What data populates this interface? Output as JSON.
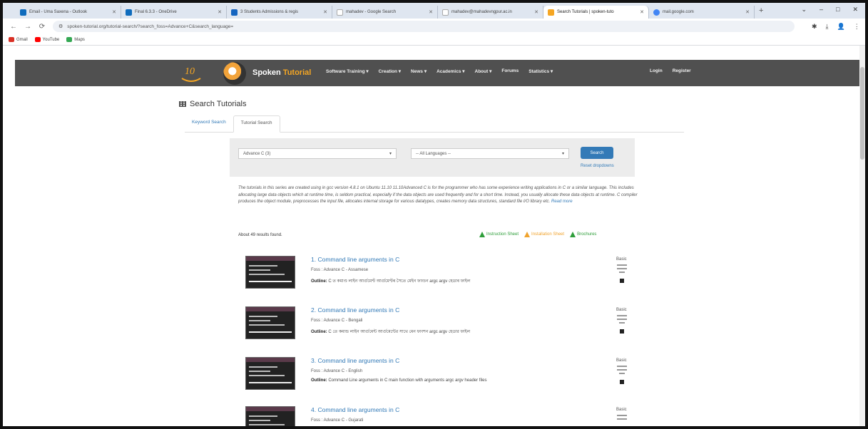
{
  "browser": {
    "tabs": [
      {
        "title": "Email - Uma Saxena - Outlook",
        "color": "#0f6cbd",
        "active": false
      },
      {
        "title": "Final 6.3.3 - OneDrive",
        "color": "#0f6cbd",
        "active": false
      },
      {
        "title": "3 Students Admissions & regis",
        "color": "#1565c0",
        "active": false
      },
      {
        "title": "mahadev - Google Search",
        "color": "#ffffff",
        "active": false
      },
      {
        "title": "mahadev@mahadevngpur.ac.in",
        "color": "#ffffff",
        "active": false
      },
      {
        "title": "Search Tutorials | spoken-tuto",
        "color": "#f5a623",
        "active": true
      },
      {
        "title": "mail.google.com",
        "color": "#4285f4",
        "active": false
      }
    ],
    "new_tab": "+",
    "window_controls": {
      "dropdown": "⌄",
      "minimize": "–",
      "maximize": "□",
      "close": "✕"
    },
    "nav": {
      "back": "←",
      "forward": "→",
      "reload": "⟳"
    },
    "url": "spoken-tutorial.org/tutorial-search/?search_foss=Advance+C&search_language=",
    "toolbar_icons": {
      "extensions": "✱",
      "download": "⤓",
      "profile": "👤",
      "menu": "⋮"
    },
    "bookmarks": [
      {
        "label": "Gmail",
        "color": "#d93025"
      },
      {
        "label": "YouTube",
        "color": "#ff0000"
      },
      {
        "label": "Maps",
        "color": "#34a853"
      }
    ]
  },
  "site": {
    "logo_text": "10",
    "brand_main": "Spoken",
    "brand_accent": " Tutorial",
    "menu": [
      "Software Training ▾",
      "Creation ▾",
      "News ▾",
      "Academics ▾",
      "About ▾",
      "Forums",
      "Statistics ▾"
    ],
    "menu_right": [
      "Login",
      "Register"
    ]
  },
  "page": {
    "heading": "Search Tutorials",
    "tabs": [
      {
        "label": "Keyword Search",
        "active": false
      },
      {
        "label": "Tutorial Search",
        "active": true
      }
    ],
    "filter": {
      "foss_value": "Advance C (3)",
      "language_value": "-- All Languages --",
      "search_label": "Search",
      "reset_label": "Reset dropdowns"
    },
    "description": "The tutorials in this series are created using in gcc version 4.8.1 on Ubuntu 11.10 11.10Advanced C is for the programmer who has some experience writing applications in C or a similar language. This includes allocating large data objects which at runtime time, is seldom practical, especially if the data objects are used frequently and for a short time. Instead, you usually allocate these data objects at runtime. C compiler produces the object module, preprocesses the input file, allocates internal storage for various datatypes, creates memory data structures, standard file I/O library etc.",
    "read_more": "Read more",
    "found_text": "About 49 results found.",
    "legend": [
      {
        "label": "Instruction Sheet",
        "color": "#2e9e3a"
      },
      {
        "label": "Installation Sheet",
        "color": "#f0a32e"
      },
      {
        "label": "Brochures",
        "color": "#2e9e3a"
      }
    ],
    "results": [
      {
        "title": "1. Command line arguments in C",
        "foss": "Foss : Advance C - Assamese",
        "outline_label": "Outline:",
        "outline": "C ত কমাণ্ড লাইন আৰ্গুমেণ্ট আৰ্গুমেণ্টৰ সৈতে মেইন ফাংচন argc argv হেডাৰ ফাইল",
        "level": "Basic"
      },
      {
        "title": "2. Command line arguments in C",
        "foss": "Foss : Advance C - Bengali",
        "outline_label": "Outline:",
        "outline": "C তে কমান্ড লাইন আর্গুমেন্ট আর্গুমেন্টের সাথে মেন ফাংশন argc argv হেডার ফাইল",
        "level": "Basic"
      },
      {
        "title": "3. Command line arguments in C",
        "foss": "Foss : Advance C - English",
        "outline_label": "Outline:",
        "outline": "Command Line arguments in C main function with arguments argc argv header files",
        "level": "Basic"
      },
      {
        "title": "4. Command line arguments in C",
        "foss": "Foss : Advance C - Gujarati",
        "outline_label": "Outline:",
        "outline": "",
        "level": "Basic"
      }
    ]
  }
}
